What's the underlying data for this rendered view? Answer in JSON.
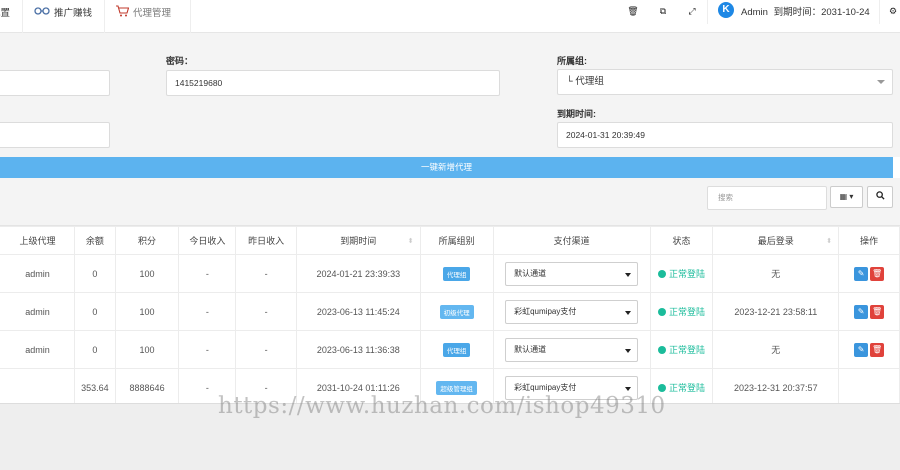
{
  "topbar": {
    "tabs": [
      {
        "label": "配置",
        "icon": ""
      },
      {
        "label": "推广赚钱",
        "icon": "glasses-icon"
      },
      {
        "label": "代理管理",
        "icon": "cart-icon"
      }
    ],
    "user": "Admin",
    "expire_label": "到期时间：",
    "expire_date": "2031-10-24"
  },
  "form": {
    "password_label": "密码：",
    "password_value": "1415219680",
    "group_label": "所属组:",
    "group_value": "└ 代理组",
    "expire_label": "到期时间:",
    "expire_value": "2024-01-31 20:39:49",
    "add_button": "一键新增代理"
  },
  "toolbar": {
    "search_placeholder": "搜索",
    "columns_button": "▾"
  },
  "table": {
    "headers": [
      "上级代理",
      "余额",
      "积分",
      "今日收入",
      "昨日收入",
      "到期时间",
      "所属组别",
      "支付渠道",
      "状态",
      "最后登录",
      "操作"
    ],
    "rows": [
      {
        "parent": "admin",
        "balance": "0",
        "points": "100",
        "today": "-",
        "yesterday": "-",
        "expire": "2024-01-21 23:39:33",
        "group": "代理组",
        "pay": "默认通道",
        "status": "正常登陆",
        "last_login": "无",
        "ops": true
      },
      {
        "parent": "admin",
        "balance": "0",
        "points": "100",
        "today": "-",
        "yesterday": "-",
        "expire": "2023-06-13 11:45:24",
        "group": "初级代理",
        "pay": "彩虹qumipay支付",
        "status": "正常登陆",
        "last_login": "2023-12-21 23:58:11",
        "ops": true
      },
      {
        "parent": "admin",
        "balance": "0",
        "points": "100",
        "today": "-",
        "yesterday": "-",
        "expire": "2023-06-13 11:36:38",
        "group": "代理组",
        "pay": "默认通道",
        "status": "正常登陆",
        "last_login": "无",
        "ops": true
      },
      {
        "parent": "",
        "balance": "353.64",
        "points": "8888646",
        "today": "-",
        "yesterday": "-",
        "expire": "2031-10-24 01:11:26",
        "group": "超级管理组",
        "pay": "彩虹qumipay支付",
        "status": "正常登陆",
        "last_login": "2023-12-31 20:37:57",
        "ops": false
      }
    ]
  },
  "watermark": "https://www.huzhan.com/ishop49310",
  "colors": {
    "accent": "#5cb3ef",
    "status": "#1bbc9b",
    "delete": "#e0423b",
    "edit": "#3a95dd"
  }
}
